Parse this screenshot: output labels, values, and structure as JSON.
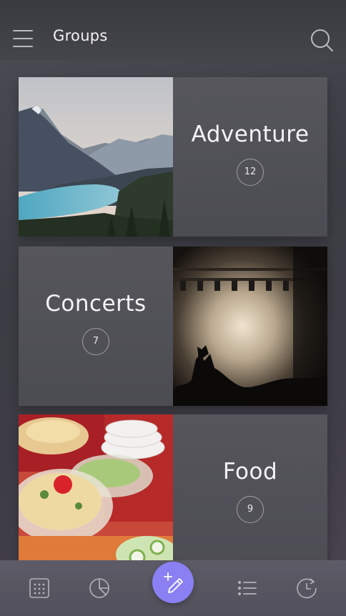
{
  "header": {
    "title": "Groups",
    "menu_icon": "hamburger-menu-icon",
    "search_icon": "search-icon"
  },
  "groups": [
    {
      "name": "Adventure",
      "count": "12",
      "image": "mountain-lake-photo"
    },
    {
      "name": "Concerts",
      "count": "7",
      "image": "concert-crowd-photo"
    },
    {
      "name": "Food",
      "count": "9",
      "image": "salad-bowls-photo"
    }
  ],
  "tabbar": {
    "tabs": [
      "calendar-icon",
      "pie-chart-icon",
      "compose-icon",
      "list-icon",
      "history-icon"
    ],
    "fab_color": "#8a80f3"
  },
  "colors": {
    "accent": "#8a80f3",
    "background": "#43444b"
  }
}
